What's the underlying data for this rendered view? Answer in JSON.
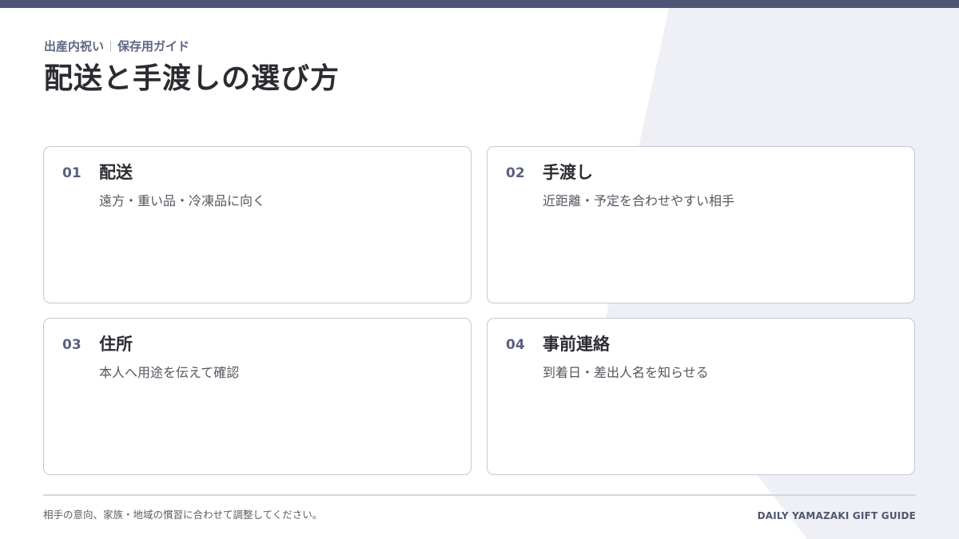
{
  "theme": {
    "accent": "#4f5675",
    "panel_bg": "#eef0f6",
    "card_border": "#c4c8d6"
  },
  "header": {
    "kicker_left": "出産内祝い",
    "kicker_right": "保存用ガイド",
    "title": "配送と手渡しの選び方"
  },
  "cards": [
    {
      "num": "01",
      "title": "配送",
      "desc": "遠方・重い品・冷凍品に向く"
    },
    {
      "num": "02",
      "title": "手渡し",
      "desc": "近距離・予定を合わせやすい相手"
    },
    {
      "num": "03",
      "title": "住所",
      "desc": "本人へ用途を伝えて確認"
    },
    {
      "num": "04",
      "title": "事前連絡",
      "desc": "到着日・差出人名を知らせる"
    }
  ],
  "footer": {
    "note": "相手の意向、家族・地域の慣習に合わせて調整してください。",
    "brand": "DAILY YAMAZAKI GIFT GUIDE"
  }
}
